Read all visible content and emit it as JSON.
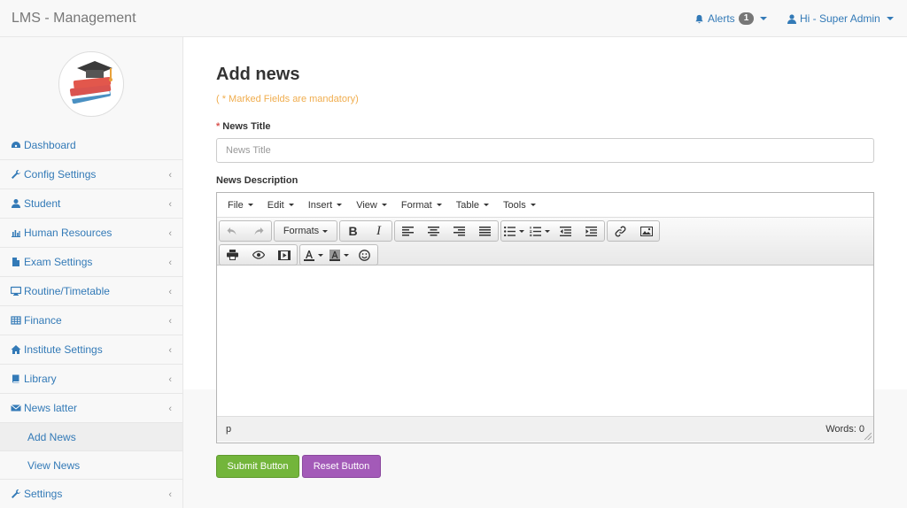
{
  "navbar": {
    "brand": "LMS - Management",
    "alerts_label": "Alerts",
    "alerts_count": "1",
    "user_label": "Hi - Super Admin"
  },
  "sidebar": {
    "items": [
      {
        "label": "Dashboard",
        "icon": "dashboard-icon"
      },
      {
        "label": "Config Settings",
        "icon": "wrench-icon"
      },
      {
        "label": "Student",
        "icon": "user-icon"
      },
      {
        "label": "Human Resources",
        "icon": "bar-chart-icon"
      },
      {
        "label": "Exam Settings",
        "icon": "file-icon"
      },
      {
        "label": "Routine/Timetable",
        "icon": "monitor-icon"
      },
      {
        "label": "Finance",
        "icon": "table-icon"
      },
      {
        "label": "Institute Settings",
        "icon": "home-icon"
      },
      {
        "label": "Library",
        "icon": "book-icon"
      },
      {
        "label": "News latter",
        "icon": "envelope-icon"
      }
    ],
    "subitems": [
      {
        "label": "Add News"
      },
      {
        "label": "View News"
      }
    ],
    "last_item": {
      "label": "Settings",
      "icon": "wrench-icon"
    }
  },
  "form": {
    "title": "Add news",
    "mandatory_note": "( * Marked Fields are mandatory)",
    "news_title_label": "News Title",
    "news_title_placeholder": "News Title",
    "news_desc_label": "News Description"
  },
  "editor": {
    "menus": [
      "File",
      "Edit",
      "Insert",
      "View",
      "Format",
      "Table",
      "Tools"
    ],
    "formats_label": "Formats",
    "status_path": "p",
    "word_count": "Words: 0"
  },
  "buttons": {
    "submit": "Submit Button",
    "reset": "Reset Button"
  },
  "colors": {
    "link": "#337ab7",
    "mandatory": "#f0ad4e",
    "submit": "#73b53b",
    "reset": "#a35ab8"
  }
}
